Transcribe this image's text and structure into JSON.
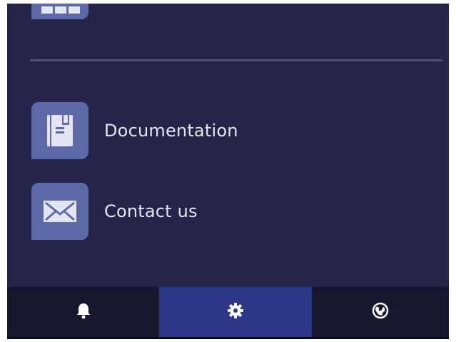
{
  "menu": {
    "items": [
      {
        "label": "Documentation",
        "icon": "documentation-icon"
      },
      {
        "label": "Contact us",
        "icon": "mail-icon"
      }
    ]
  },
  "bottom_nav": {
    "tabs": [
      {
        "icon": "bell-icon",
        "active": false
      },
      {
        "icon": "gear-icon",
        "active": true
      },
      {
        "icon": "globe-icon",
        "active": false
      }
    ]
  },
  "colors": {
    "background": "#26244b",
    "icon_tile": "#5e6aa8",
    "bottom_bar": "#17162f",
    "active_tab": "#2c3787",
    "text": "#e6e6f0"
  }
}
